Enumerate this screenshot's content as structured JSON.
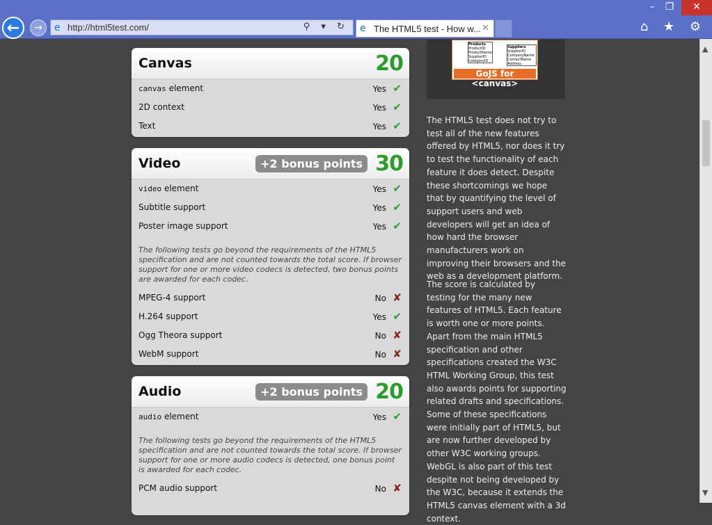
{
  "browser": {
    "url": "http://html5test.com/",
    "tab_title": "The HTML5 test - How w...",
    "tab_close": "✕",
    "controls": {
      "minimize": "–",
      "maximize": "❐",
      "close": "✕"
    },
    "right_icons": "⌂ ★ ⚙",
    "address_tools": "⚲ ▾ ↻"
  },
  "cards": {
    "canvas": {
      "title": "Canvas",
      "score": "20",
      "rows": [
        {
          "label_mono": "canvas",
          "label_rest": " element",
          "value": "Yes",
          "mark": "✔"
        },
        {
          "label": "2D context",
          "value": "Yes",
          "mark": "✔"
        },
        {
          "label": "Text",
          "value": "Yes",
          "mark": "✔"
        }
      ]
    },
    "video": {
      "title": "Video",
      "bonus": "+2 bonus points",
      "score": "30",
      "rows": [
        {
          "label_mono": "video",
          "label_rest": " element",
          "value": "Yes",
          "mark": "✔"
        },
        {
          "label": "Subtitle support",
          "value": "Yes",
          "mark": "✔"
        },
        {
          "label": "Poster image support",
          "value": "Yes",
          "mark": "✔"
        }
      ],
      "note": "The following tests go beyond the requirements of the HTML5 specification and are not counted towards the total score. If browser support for one or more video codecs is detected, two bonus points are awarded for each codec.",
      "codecs": [
        {
          "label": "MPEG-4 support",
          "value": "No",
          "mark": "✘"
        },
        {
          "label": "H.264 support",
          "value": "Yes",
          "mark": "✔"
        },
        {
          "label": "Ogg Theora support",
          "value": "No",
          "mark": "✘"
        },
        {
          "label": "WebM support",
          "value": "No",
          "mark": "✘"
        }
      ]
    },
    "audio": {
      "title": "Audio",
      "bonus": "+2 bonus points",
      "score": "20",
      "rows": [
        {
          "label_mono": "audio",
          "label_rest": " element",
          "value": "Yes",
          "mark": "✔"
        }
      ],
      "note": "The following tests go beyond the requirements of the HTML5 specification and are not counted towards the total score. If browser support for one or more audio codecs is detected, one bonus point is awarded for each codec.",
      "codecs": [
        {
          "label": "PCM audio support",
          "value": "No",
          "mark": "✘"
        }
      ]
    }
  },
  "sidebar": {
    "ad": {
      "box1_title": "Products",
      "box1_lines": "ProductID ProductName SupplierID CategoryID",
      "box2_title": "Suppliers",
      "box2_lines": "SupplierID CompanyName ContactName Address",
      "banner": "GoJS for <canvas>"
    },
    "para1": "The HTML5 test does not try to test all of the new features offered by HTML5, nor does it try to test the functionality of each feature it does detect. Despite these shortcomings we hope that by quantifying the level of support users and web developers will get an idea of how hard the browser manufacturers work on improving their browsers and the web as a development platform.",
    "para2": "The score is calculated by testing for the many new features of HTML5. Each feature is worth one or more points. Apart from the main HTML5 specification and other specifications created the W3C HTML Working Group, this test also awards points for supporting related drafts and specifications. Some of these specifications were initially part of HTML5, but are now further developed by other W3C working groups. WebGL is also part of this test despite not being developed by the W3C, because it extends the HTML5 canvas element with a 3d context."
  }
}
